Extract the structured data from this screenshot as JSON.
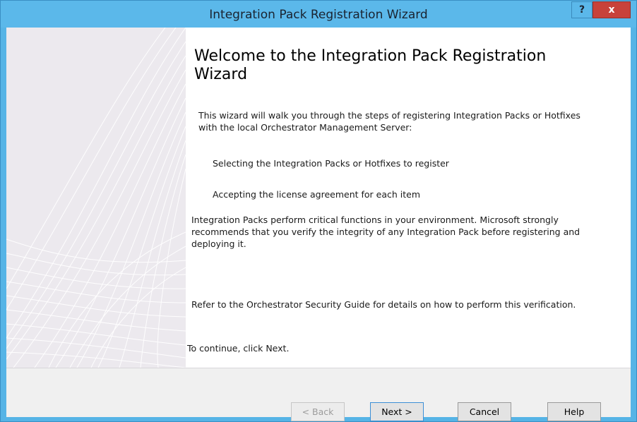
{
  "window": {
    "title": "Integration Pack Registration Wizard",
    "help_label": "?",
    "close_label": "x"
  },
  "main": {
    "heading": "Welcome to the Integration Pack Registration Wizard",
    "intro": "This wizard will walk you through the steps of registering Integration Packs or Hotfixes with the local Orchestrator Management Server:",
    "steps": [
      "Selecting the Integration Packs or Hotfixes to register",
      "Accepting the license agreement for each item"
    ],
    "warning": "Integration Packs perform critical functions in your environment.  Microsoft strongly recommends that you verify the integrity of any Integration Pack before registering and deploying it.",
    "reference": "Refer to the Orchestrator Security Guide for details on how to perform this verification.",
    "continue": "To continue, click Next."
  },
  "buttons": {
    "back": "< Back",
    "next": "Next >",
    "cancel": "Cancel",
    "help": "Help"
  },
  "colors": {
    "titlebar": "#5bb8ea",
    "close": "#c8423a",
    "banner": "#ece9ee"
  }
}
